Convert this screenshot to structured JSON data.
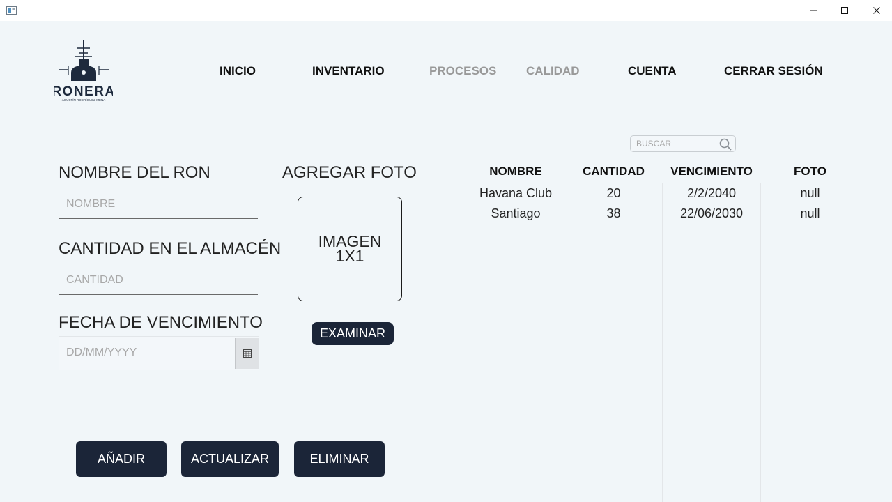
{
  "window": {
    "controls": {
      "minimize": "—",
      "maximize": "☐",
      "close": "✕"
    }
  },
  "logo": {
    "brand": "RONERA",
    "tagline": "AGUSTÍN RODRÍGUEZ MENA"
  },
  "nav": {
    "items": [
      {
        "label": "INICIO",
        "state": "normal"
      },
      {
        "label": "INVENTARIO",
        "state": "active"
      },
      {
        "label": "PROCESOS",
        "state": "disabled"
      },
      {
        "label": "CALIDAD",
        "state": "disabled"
      },
      {
        "label": "CUENTA",
        "state": "normal"
      },
      {
        "label": "CERRAR SESIÓN",
        "state": "normal"
      }
    ]
  },
  "form": {
    "name_label": "NOMBRE DEL RON",
    "name_placeholder": "NOMBRE",
    "qty_label": "CANTIDAD EN EL ALMACÉN",
    "qty_placeholder": "CANTIDAD",
    "date_label": "FECHA DE VENCIMIENTO",
    "date_placeholder": "DD/MM/YYYY"
  },
  "photo": {
    "label": "AGREGAR FOTO",
    "placeholder": "IMAGEN 1X1",
    "browse_button": "EXAMINAR"
  },
  "actions": {
    "add": "AÑADIR",
    "update": "ACTUALIZAR",
    "delete": "ELIMINAR"
  },
  "search": {
    "placeholder": "BUSCAR"
  },
  "table": {
    "columns": [
      "NOMBRE",
      "CANTIDAD",
      "VENCIMIENTO",
      "FOTO"
    ],
    "rows": [
      [
        "Havana Club",
        "20",
        "2/2/2040",
        "null"
      ],
      [
        "Santiago",
        "38",
        "22/06/2030",
        "null"
      ]
    ]
  },
  "colors": {
    "background": "#f1f6f9",
    "button_dark": "#1b2538",
    "nav_disabled": "#999999"
  }
}
